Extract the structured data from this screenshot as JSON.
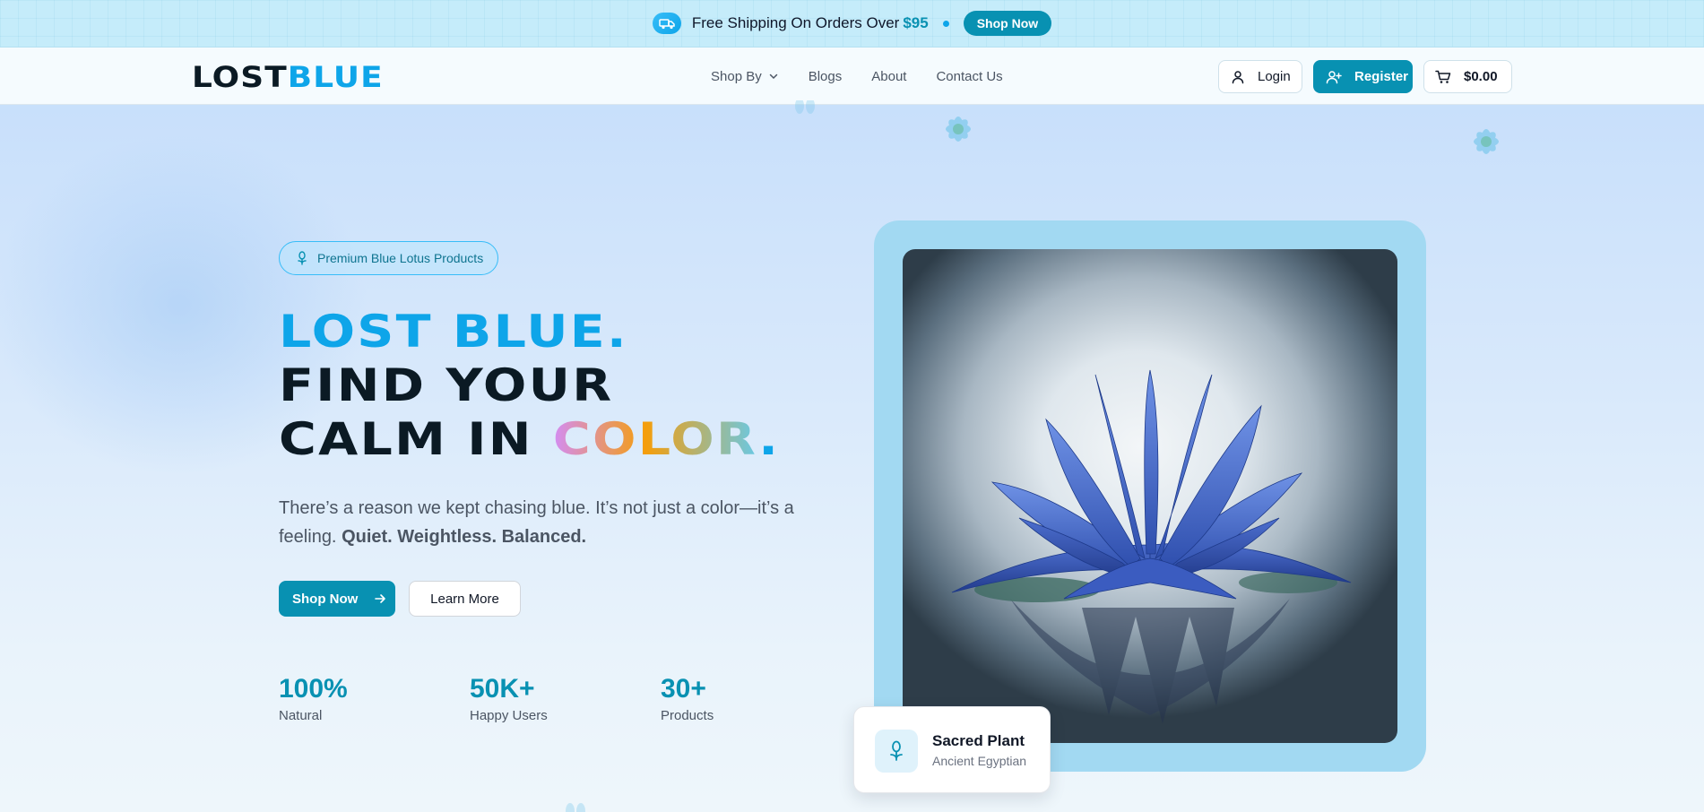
{
  "announcement": {
    "text": "Free Shipping On Orders Over",
    "price": "$95",
    "button_label": "Shop Now"
  },
  "header": {
    "logo_dark": "LOST",
    "logo_blue": "BLUE",
    "nav": [
      {
        "label": "Shop By",
        "has_dropdown": true
      },
      {
        "label": "Blogs"
      },
      {
        "label": "About"
      },
      {
        "label": "Contact Us"
      }
    ],
    "login_label": "Login",
    "register_label": "Register",
    "cart_total": "$0.00"
  },
  "hero": {
    "badge": "Premium Blue Lotus Products",
    "headline_line1": "LOST BLUE.",
    "headline_line2": "FIND YOUR",
    "headline_line3_prefix": "CALM IN",
    "headline_line3_color": "COLOR",
    "headline_line3_dot": ".",
    "description": "There’s a reason we kept chasing blue. It’s not just a color—it’s a feeling.",
    "description_bold": "Quiet. Weightless. Balanced.",
    "primary_button": "Shop Now",
    "secondary_button": "Learn More",
    "stats": [
      {
        "value": "100%",
        "label": "Natural"
      },
      {
        "value": "50K+",
        "label": "Happy Users"
      },
      {
        "value": "30+",
        "label": "Products"
      }
    ]
  },
  "feature_card": {
    "title": "Sacred Plant",
    "subtitle": "Ancient Egyptian"
  },
  "colors": {
    "accent": "#0891b2",
    "brand_blue": "#0ea5e9",
    "frame": "#a2d9f2",
    "background": "#d7e8fb"
  }
}
